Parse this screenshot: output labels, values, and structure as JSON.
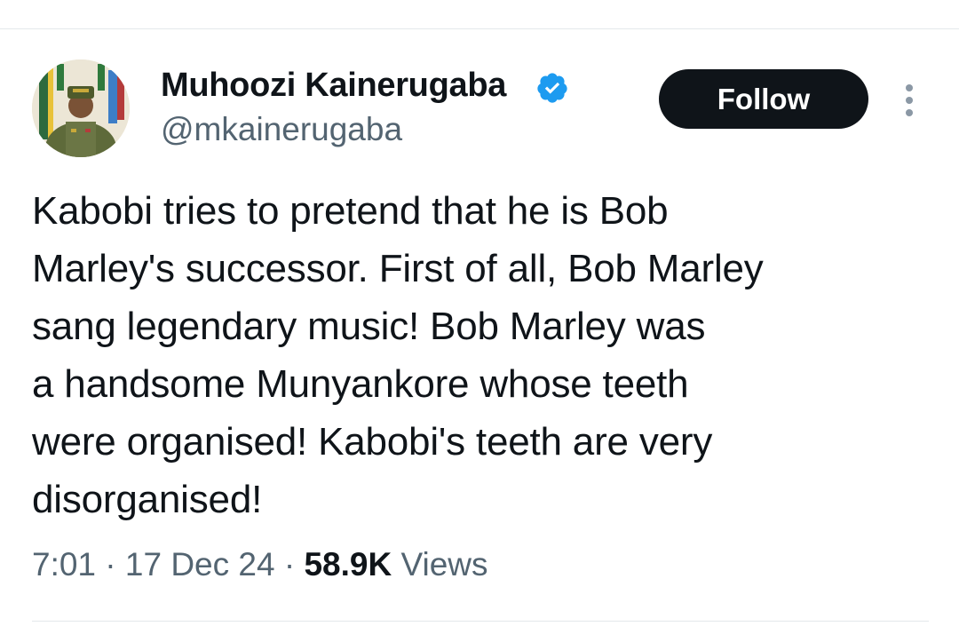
{
  "tweet": {
    "author": {
      "display_name": "Muhoozi Kainerugaba",
      "handle": "@mkainerugaba",
      "verified": true,
      "avatar_icon": "profile-photo"
    },
    "follow_label": "Follow",
    "more_icon": "more-vertical-icon",
    "text": "Kabobi tries to pretend that he is Bob\nMarley's successor. First of all, Bob Marley\nsang legendary music! Bob Marley was\na handsome Munyankore whose teeth\nwere organised! Kabobi's teeth are very\ndisorganised!",
    "meta": {
      "time": "7:01",
      "separator": " · ",
      "date": "17 Dec 24",
      "views_count": "58.9K",
      "views_label": " Views"
    }
  },
  "colors": {
    "primary_text": "#0f1419",
    "secondary_text": "#536471",
    "verified_blue": "#1d9bf0",
    "follow_bg": "#0f1419",
    "divider": "#e4e8eb"
  }
}
